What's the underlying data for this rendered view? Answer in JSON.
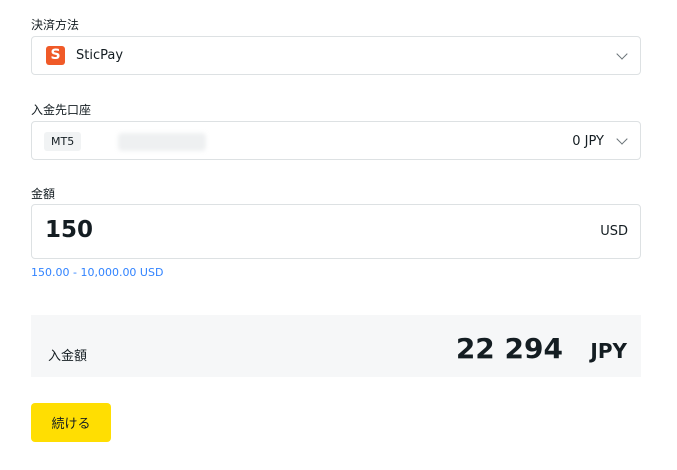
{
  "payment_method": {
    "label": "決済方法",
    "selected": "SticPay",
    "logo_letter": "S",
    "logo_color": "#f05a28"
  },
  "deposit_account": {
    "label": "入金先口座",
    "platform": "MT5",
    "balance": "0 JPY"
  },
  "amount": {
    "label": "金額",
    "value": "150",
    "currency": "USD",
    "range_hint": "150.00 - 10,000.00 USD"
  },
  "summary": {
    "label": "入金額",
    "value": "22 294",
    "currency": "JPY"
  },
  "actions": {
    "continue_label": "続ける",
    "button_color": "#ffde02"
  },
  "colors": {
    "accent_link": "#3183ff",
    "text": "#141d22",
    "border": "#dde1e3",
    "summary_bg": "#f6f7f8"
  }
}
